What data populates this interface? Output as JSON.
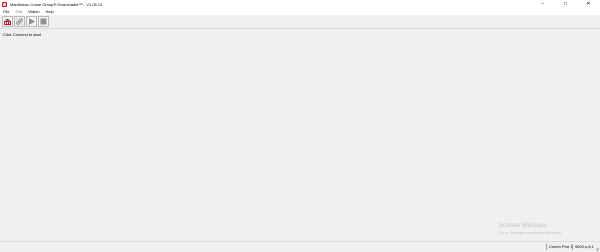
{
  "window": {
    "title": "Manitowoc Crane Group® Downloader™ - V1.05.12",
    "controls": {
      "minimize": "–",
      "maximize": "□",
      "close": "✕"
    }
  },
  "menu": {
    "items": [
      {
        "label": "File",
        "enabled": true
      },
      {
        "label": "Edit",
        "enabled": false
      },
      {
        "label": "Watch",
        "enabled": true
      },
      {
        "label": "Help",
        "enabled": true
      }
    ]
  },
  "toolbar": {
    "buttons": [
      {
        "icon": "connect-icon",
        "enabled": true
      },
      {
        "icon": "disconnect-icon",
        "enabled": false
      },
      {
        "icon": "play-icon",
        "enabled": false
      },
      {
        "icon": "stop-icon",
        "enabled": false
      }
    ]
  },
  "main": {
    "status_message": "Click Connect to start"
  },
  "watermark": {
    "title": "Activate Windows",
    "subtitle": "Go to Settings to activate Windows."
  },
  "statusbar": {
    "port": "Comm Port 1",
    "settings": "9600,n,8,1"
  },
  "colors": {
    "accent_red": "#c8102e",
    "disabled_gray": "#9a9a9a",
    "background": "#f0f0f0"
  }
}
